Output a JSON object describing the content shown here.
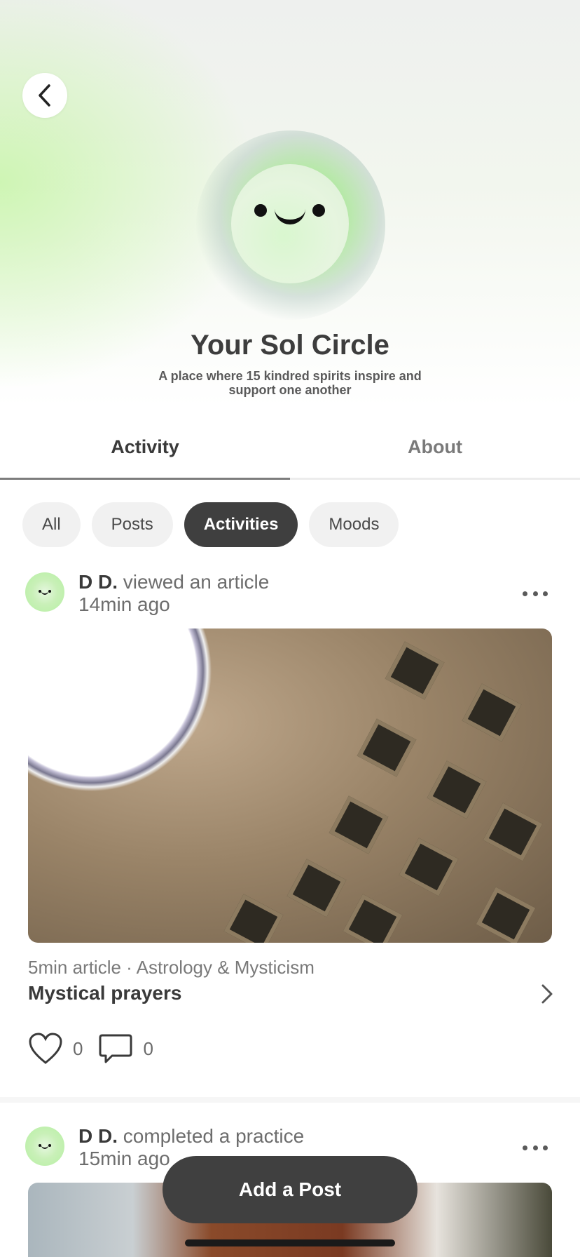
{
  "header": {
    "back_icon": "chevron-left-icon",
    "title": "Your Sol Circle",
    "subtitle": "A place where 15 kindred spirits inspire and support one another"
  },
  "tabs": [
    {
      "label": "Activity",
      "active": true
    },
    {
      "label": "About",
      "active": false
    }
  ],
  "filters": {
    "items": [
      "All",
      "Posts",
      "Activities",
      "Moods"
    ],
    "selected": "Activities"
  },
  "feed": [
    {
      "user": "D D.",
      "action": "viewed an article",
      "time": "14min ago",
      "meta": "5min article · Astrology & Mysticism",
      "title": "Mystical prayers",
      "likes": "0",
      "comments": "0"
    },
    {
      "user": "D D.",
      "action": "completed a practice",
      "time": "15min ago"
    }
  ],
  "fab_label": "Add a Post",
  "colors": {
    "accent_dark": "#404040",
    "glow_green": "#7be85a"
  }
}
